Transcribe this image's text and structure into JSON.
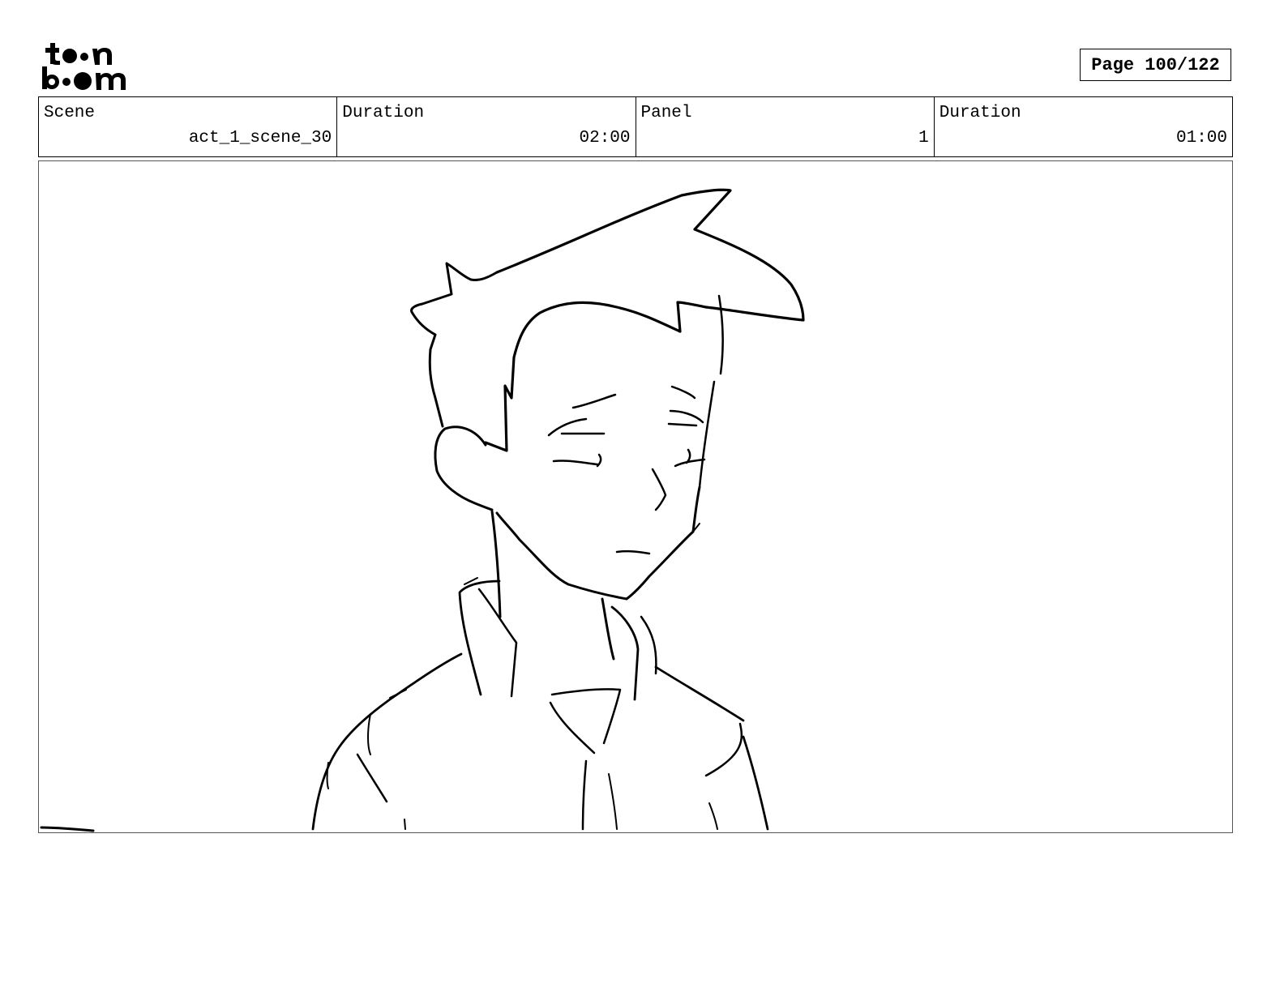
{
  "header": {
    "logo_text": "toon boom",
    "page_label": "Page 100/122"
  },
  "info": [
    {
      "label": "Scene",
      "value": "act_1_scene_30"
    },
    {
      "label": "Duration",
      "value": "02:00"
    },
    {
      "label": "Panel",
      "value": "1"
    },
    {
      "label": "Duration",
      "value": "01:00"
    }
  ],
  "panel": {
    "description": ""
  }
}
